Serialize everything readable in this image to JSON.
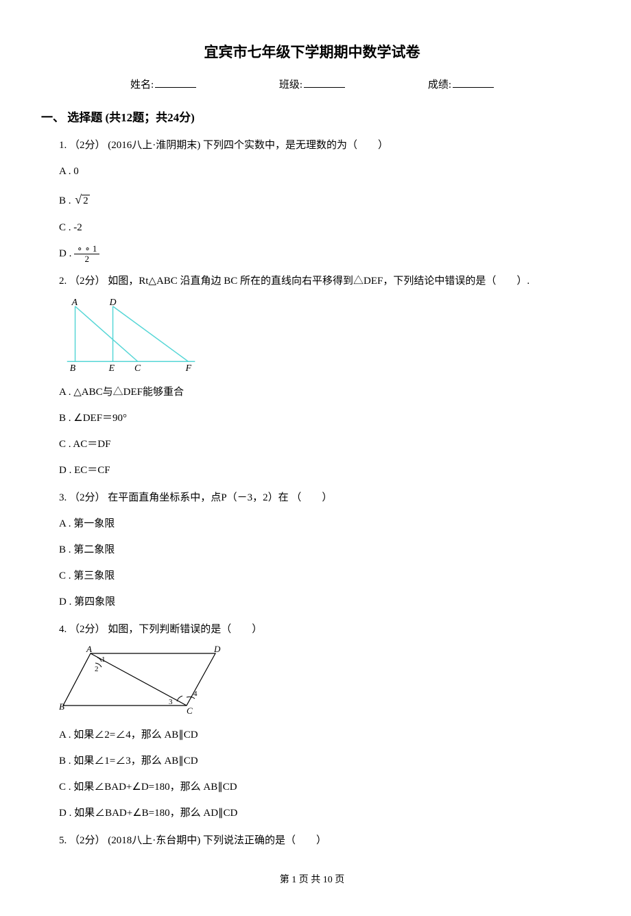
{
  "title": "宜宾市七年级下学期期中数学试卷",
  "info": {
    "name_label": "姓名:",
    "class_label": "班级:",
    "score_label": "成绩:"
  },
  "section": {
    "heading": "一、 选择题 (共12题；共24分)"
  },
  "q1": {
    "stem": "1. （2分） (2016八上·淮阴期末) 下列四个实数中，是无理数的为（　　）",
    "optA": "A . 0",
    "optB_prefix": "B . ",
    "optC": "C . -2",
    "optD_prefix": "D . "
  },
  "q2": {
    "stem": "2. （2分） 如图，Rt△ABC 沿直角边 BC 所在的直线向右平移得到△DEF，下列结论中错误的是（　　）.",
    "optA": "A . △ABC与△DEF能够重合",
    "optB": "B . ∠DEF＝90°",
    "optC": "C . AC＝DF",
    "optD": "D . EC＝CF",
    "labels": {
      "A": "A",
      "D": "D",
      "B": "B",
      "E": "E",
      "C": "C",
      "F": "F"
    }
  },
  "q3": {
    "stem": "3. （2分） 在平面直角坐标系中，点P（－3，2）在 （　　）",
    "optA": "A . 第一象限",
    "optB": "B . 第二象限",
    "optC": "C . 第三象限",
    "optD": "D . 第四象限"
  },
  "q4": {
    "stem": "4. （2分） 如图，下列判断错误的是（　　）",
    "optA": "A . 如果∠2=∠4，那么 AB∥CD",
    "optB": "B . 如果∠1=∠3，那么 AB∥CD",
    "optC": "C . 如果∠BAD+∠D=180，那么 AB∥CD",
    "optD": "D . 如果∠BAD+∠B=180，那么 AD∥CD",
    "labels": {
      "A": "A",
      "D": "D",
      "B": "B",
      "C": "C",
      "n1": "1",
      "n2": "2",
      "n3": "3",
      "n4": "4"
    }
  },
  "q5": {
    "stem": "5. （2分） (2018八上·东台期中) 下列说法正确的是（　　）"
  },
  "footer": {
    "text": "第 1 页 共 10 页"
  }
}
